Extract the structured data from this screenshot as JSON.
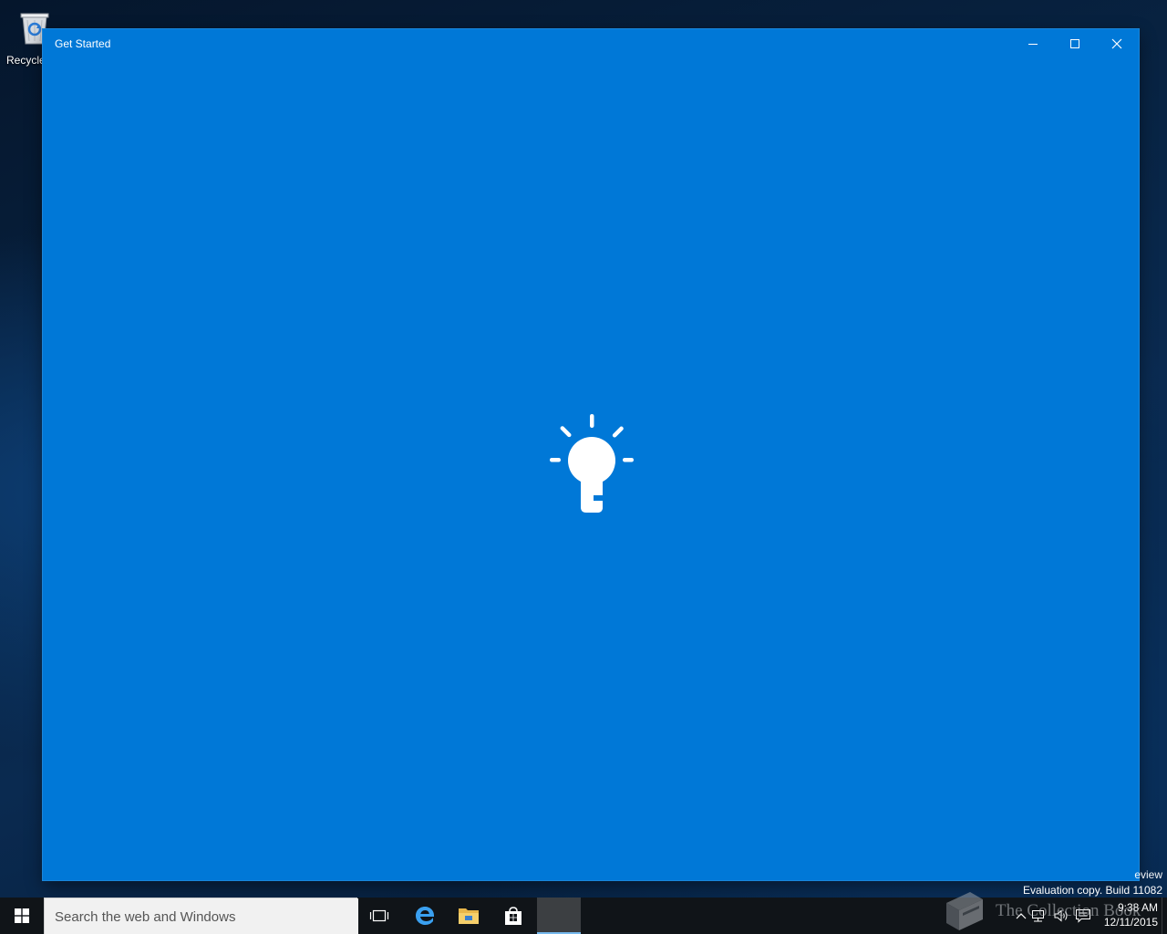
{
  "desktop": {
    "recycle_bin_label": "Recycle"
  },
  "window": {
    "title": "Get Started",
    "buttons": {
      "minimize": "minimize",
      "maximize": "maximize",
      "close": "close"
    },
    "background_color": "#0078d7",
    "loading_icon": "lightbulb-icon"
  },
  "watermark": {
    "line1": "eview",
    "line2": "Evaluation copy. Build 11082"
  },
  "taskbar": {
    "search_placeholder": "Search the web and Windows",
    "pinned": [
      "task-view-icon",
      "edge-icon",
      "file-explorer-icon",
      "store-icon"
    ],
    "clock_time": "9:38 AM",
    "clock_date": "12/11/2015"
  },
  "branding": {
    "text": "The Collection Book"
  }
}
